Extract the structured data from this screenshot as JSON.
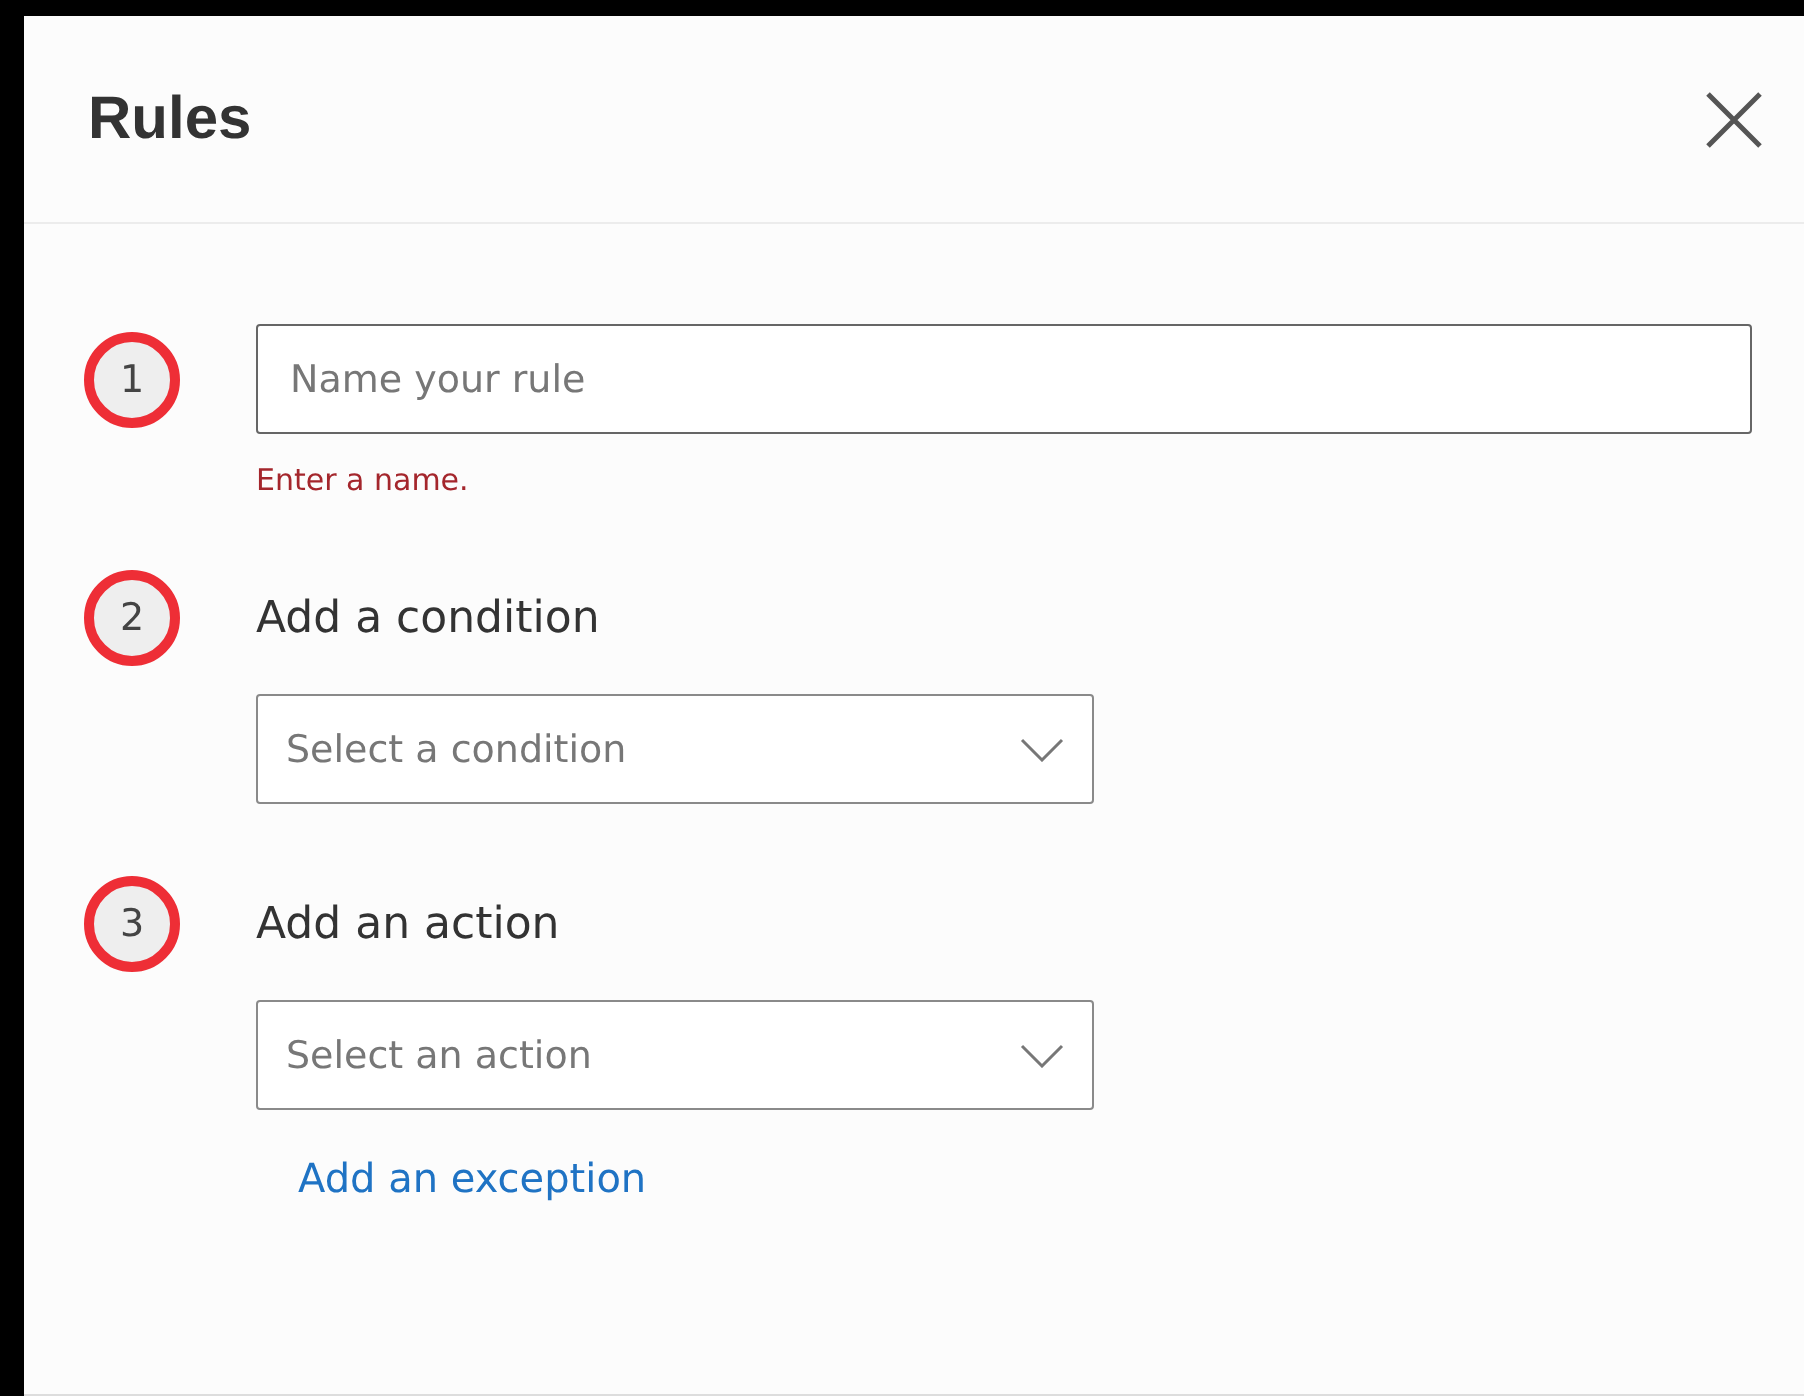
{
  "dialog": {
    "title": "Rules"
  },
  "steps": [
    {
      "kind": "text-field",
      "number": "1",
      "placeholder": "Name your rule",
      "error": "Enter a name."
    },
    {
      "kind": "dropdown",
      "number": "2",
      "heading": "Add a condition",
      "placeholder": "Select a condition"
    },
    {
      "kind": "dropdown",
      "number": "3",
      "heading": "Add an action",
      "placeholder": "Select an action"
    }
  ],
  "link": "Add an exception"
}
